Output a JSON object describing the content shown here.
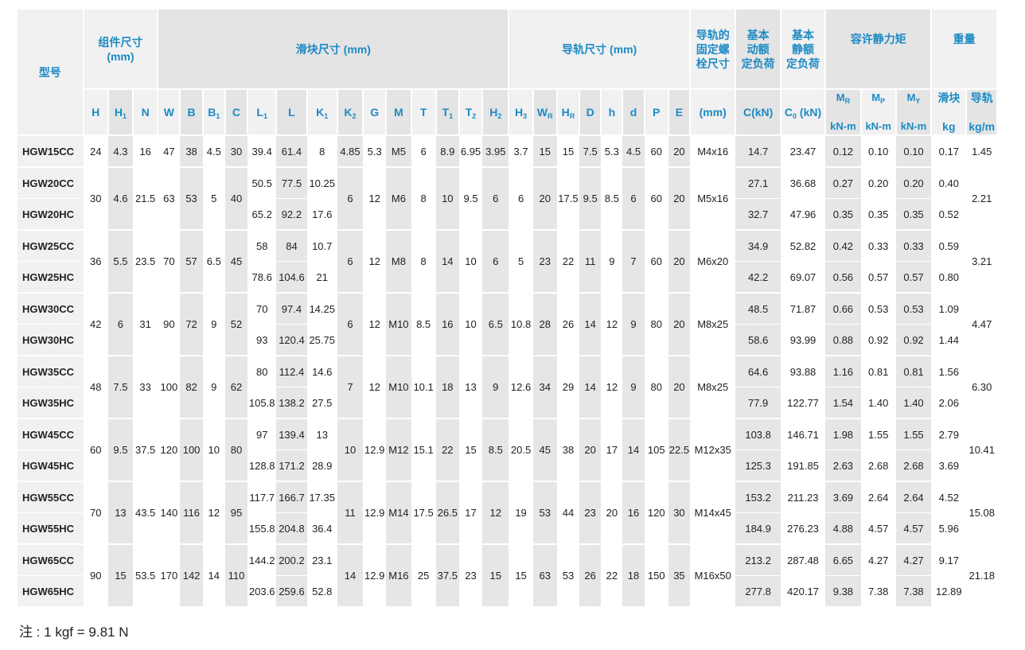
{
  "header": {
    "model": "型号",
    "assembly": "组件尺寸\n(mm)",
    "block": "滑块尺寸 (mm)",
    "rail": "导轨尺寸 (mm)",
    "bolt": "导轨的\n固定螺\n栓尺寸",
    "dynamic": "基本\n动额\n定负荷",
    "static": "基本\n静额\n定负荷",
    "moment": "容许静力矩",
    "weight": "重量",
    "MR": "M",
    "MR_sub": "R",
    "MP": "M",
    "MP_sub": "P",
    "MY": "M",
    "MY_sub": "Y",
    "block_weight": "滑块",
    "rail_weight": "导轨",
    "bolt_unit": "(mm)",
    "c_unit": "C(kN)",
    "c0_main": "C",
    "c0_sub": "0",
    "c0_unit": " (kN)",
    "moment_unit": "kN-m",
    "kg": "kg",
    "kgm": "kg/m",
    "cols": [
      {
        "m": "H",
        "s": ""
      },
      {
        "m": "H",
        "s": "1"
      },
      {
        "m": "N",
        "s": ""
      },
      {
        "m": "W",
        "s": ""
      },
      {
        "m": "B",
        "s": ""
      },
      {
        "m": "B",
        "s": "1"
      },
      {
        "m": "C",
        "s": ""
      },
      {
        "m": "L",
        "s": "1"
      },
      {
        "m": "L",
        "s": ""
      },
      {
        "m": "K",
        "s": "1"
      },
      {
        "m": "K",
        "s": "2"
      },
      {
        "m": "G",
        "s": ""
      },
      {
        "m": "M",
        "s": ""
      },
      {
        "m": "T",
        "s": ""
      },
      {
        "m": "T",
        "s": "1"
      },
      {
        "m": "T",
        "s": "2"
      },
      {
        "m": "H",
        "s": "2"
      },
      {
        "m": "H",
        "s": "3"
      },
      {
        "m": "W",
        "s": "R"
      },
      {
        "m": "H",
        "s": "R"
      },
      {
        "m": "D",
        "s": ""
      },
      {
        "m": "h",
        "s": ""
      },
      {
        "m": "d",
        "s": ""
      },
      {
        "m": "P",
        "s": ""
      },
      {
        "m": "E",
        "s": ""
      }
    ]
  },
  "groups": [
    {
      "shared": {
        "H": "24",
        "H1": "4.3",
        "N": "16",
        "W": "47",
        "B": "38",
        "B1": "4.5",
        "C": "30",
        "K2": "4.85",
        "G": "5.3",
        "M": "M5",
        "T": "6",
        "T1": "8.9",
        "T2": "6.95",
        "H2": "3.95",
        "H3": "3.7",
        "WR": "15",
        "HR": "15",
        "D": "7.5",
        "h": "5.3",
        "d": "4.5",
        "P": "60",
        "E": "20",
        "bolt": "M4x16",
        "rail_kgm": "1.45"
      },
      "rows": [
        {
          "model": "HGW15CC",
          "L1": "39.4",
          "L": "61.4",
          "K1": "8",
          "Ck": "14.7",
          "C0": "23.47",
          "MR": "0.12",
          "MP": "0.10",
          "MY": "0.10",
          "kg": "0.17"
        }
      ]
    },
    {
      "shared": {
        "H": "30",
        "H1": "4.6",
        "N": "21.5",
        "W": "63",
        "B": "53",
        "B1": "5",
        "C": "40",
        "K2": "6",
        "G": "12",
        "M": "M6",
        "T": "8",
        "T1": "10",
        "T2": "9.5",
        "H2": "6",
        "H3": "6",
        "WR": "20",
        "HR": "17.5",
        "D": "9.5",
        "h": "8.5",
        "d": "6",
        "P": "60",
        "E": "20",
        "bolt": "M5x16",
        "rail_kgm": "2.21"
      },
      "rows": [
        {
          "model": "HGW20CC",
          "L1": "50.5",
          "L": "77.5",
          "K1": "10.25",
          "Ck": "27.1",
          "C0": "36.68",
          "MR": "0.27",
          "MP": "0.20",
          "MY": "0.20",
          "kg": "0.40"
        },
        {
          "model": "HGW20HC",
          "L1": "65.2",
          "L": "92.2",
          "K1": "17.6",
          "Ck": "32.7",
          "C0": "47.96",
          "MR": "0.35",
          "MP": "0.35",
          "MY": "0.35",
          "kg": "0.52"
        }
      ]
    },
    {
      "shared": {
        "H": "36",
        "H1": "5.5",
        "N": "23.5",
        "W": "70",
        "B": "57",
        "B1": "6.5",
        "C": "45",
        "K2": "6",
        "G": "12",
        "M": "M8",
        "T": "8",
        "T1": "14",
        "T2": "10",
        "H2": "6",
        "H3": "5",
        "WR": "23",
        "HR": "22",
        "D": "11",
        "h": "9",
        "d": "7",
        "P": "60",
        "E": "20",
        "bolt": "M6x20",
        "rail_kgm": "3.21"
      },
      "rows": [
        {
          "model": "HGW25CC",
          "L1": "58",
          "L": "84",
          "K1": "10.7",
          "Ck": "34.9",
          "C0": "52.82",
          "MR": "0.42",
          "MP": "0.33",
          "MY": "0.33",
          "kg": "0.59"
        },
        {
          "model": "HGW25HC",
          "L1": "78.6",
          "L": "104.6",
          "K1": "21",
          "Ck": "42.2",
          "C0": "69.07",
          "MR": "0.56",
          "MP": "0.57",
          "MY": "0.57",
          "kg": "0.80"
        }
      ]
    },
    {
      "shared": {
        "H": "42",
        "H1": "6",
        "N": "31",
        "W": "90",
        "B": "72",
        "B1": "9",
        "C": "52",
        "K2": "6",
        "G": "12",
        "M": "M10",
        "T": "8.5",
        "T1": "16",
        "T2": "10",
        "H2": "6.5",
        "H3": "10.8",
        "WR": "28",
        "HR": "26",
        "D": "14",
        "h": "12",
        "d": "9",
        "P": "80",
        "E": "20",
        "bolt": "M8x25",
        "rail_kgm": "4.47"
      },
      "rows": [
        {
          "model": "HGW30CC",
          "L1": "70",
          "L": "97.4",
          "K1": "14.25",
          "Ck": "48.5",
          "C0": "71.87",
          "MR": "0.66",
          "MP": "0.53",
          "MY": "0.53",
          "kg": "1.09"
        },
        {
          "model": "HGW30HC",
          "L1": "93",
          "L": "120.4",
          "K1": "25.75",
          "Ck": "58.6",
          "C0": "93.99",
          "MR": "0.88",
          "MP": "0.92",
          "MY": "0.92",
          "kg": "1.44"
        }
      ]
    },
    {
      "shared": {
        "H": "48",
        "H1": "7.5",
        "N": "33",
        "W": "100",
        "B": "82",
        "B1": "9",
        "C": "62",
        "K2": "7",
        "G": "12",
        "M": "M10",
        "T": "10.1",
        "T1": "18",
        "T2": "13",
        "H2": "9",
        "H3": "12.6",
        "WR": "34",
        "HR": "29",
        "D": "14",
        "h": "12",
        "d": "9",
        "P": "80",
        "E": "20",
        "bolt": "M8x25",
        "rail_kgm": "6.30"
      },
      "rows": [
        {
          "model": "HGW35CC",
          "L1": "80",
          "L": "112.4",
          "K1": "14.6",
          "Ck": "64.6",
          "C0": "93.88",
          "MR": "1.16",
          "MP": "0.81",
          "MY": "0.81",
          "kg": "1.56"
        },
        {
          "model": "HGW35HC",
          "L1": "105.8",
          "L": "138.2",
          "K1": "27.5",
          "Ck": "77.9",
          "C0": "122.77",
          "MR": "1.54",
          "MP": "1.40",
          "MY": "1.40",
          "kg": "2.06"
        }
      ]
    },
    {
      "shared": {
        "H": "60",
        "H1": "9.5",
        "N": "37.5",
        "W": "120",
        "B": "100",
        "B1": "10",
        "C": "80",
        "K2": "10",
        "G": "12.9",
        "M": "M12",
        "T": "15.1",
        "T1": "22",
        "T2": "15",
        "H2": "8.5",
        "H3": "20.5",
        "WR": "45",
        "HR": "38",
        "D": "20",
        "h": "17",
        "d": "14",
        "P": "105",
        "E": "22.5",
        "bolt": "M12x35",
        "rail_kgm": "10.41"
      },
      "rows": [
        {
          "model": "HGW45CC",
          "L1": "97",
          "L": "139.4",
          "K1": "13",
          "Ck": "103.8",
          "C0": "146.71",
          "MR": "1.98",
          "MP": "1.55",
          "MY": "1.55",
          "kg": "2.79"
        },
        {
          "model": "HGW45HC",
          "L1": "128.8",
          "L": "171.2",
          "K1": "28.9",
          "Ck": "125.3",
          "C0": "191.85",
          "MR": "2.63",
          "MP": "2.68",
          "MY": "2.68",
          "kg": "3.69"
        }
      ]
    },
    {
      "shared": {
        "H": "70",
        "H1": "13",
        "N": "43.5",
        "W": "140",
        "B": "116",
        "B1": "12",
        "C": "95",
        "K2": "11",
        "G": "12.9",
        "M": "M14",
        "T": "17.5",
        "T1": "26.5",
        "T2": "17",
        "H2": "12",
        "H3": "19",
        "WR": "53",
        "HR": "44",
        "D": "23",
        "h": "20",
        "d": "16",
        "P": "120",
        "E": "30",
        "bolt": "M14x45",
        "rail_kgm": "15.08"
      },
      "rows": [
        {
          "model": "HGW55CC",
          "L1": "117.7",
          "L": "166.7",
          "K1": "17.35",
          "Ck": "153.2",
          "C0": "211.23",
          "MR": "3.69",
          "MP": "2.64",
          "MY": "2.64",
          "kg": "4.52"
        },
        {
          "model": "HGW55HC",
          "L1": "155.8",
          "L": "204.8",
          "K1": "36.4",
          "Ck": "184.9",
          "C0": "276.23",
          "MR": "4.88",
          "MP": "4.57",
          "MY": "4.57",
          "kg": "5.96"
        }
      ]
    },
    {
      "shared": {
        "H": "90",
        "H1": "15",
        "N": "53.5",
        "W": "170",
        "B": "142",
        "B1": "14",
        "C": "110",
        "K2": "14",
        "G": "12.9",
        "M": "M16",
        "T": "25",
        "T1": "37.5",
        "T2": "23",
        "H2": "15",
        "H3": "15",
        "WR": "63",
        "HR": "53",
        "D": "26",
        "h": "22",
        "d": "18",
        "P": "150",
        "E": "35",
        "bolt": "M16x50",
        "rail_kgm": "21.18"
      },
      "rows": [
        {
          "model": "HGW65CC",
          "L1": "144.2",
          "L": "200.2",
          "K1": "23.1",
          "Ck": "213.2",
          "C0": "287.48",
          "MR": "6.65",
          "MP": "4.27",
          "MY": "4.27",
          "kg": "9.17"
        },
        {
          "model": "HGW65HC",
          "L1": "203.6",
          "L": "259.6",
          "K1": "52.8",
          "Ck": "277.8",
          "C0": "420.17",
          "MR": "9.38",
          "MP": "7.38",
          "MY": "7.38",
          "kg": "12.89"
        }
      ]
    }
  ],
  "note": "注 : 1 kgf = 9.81 N"
}
